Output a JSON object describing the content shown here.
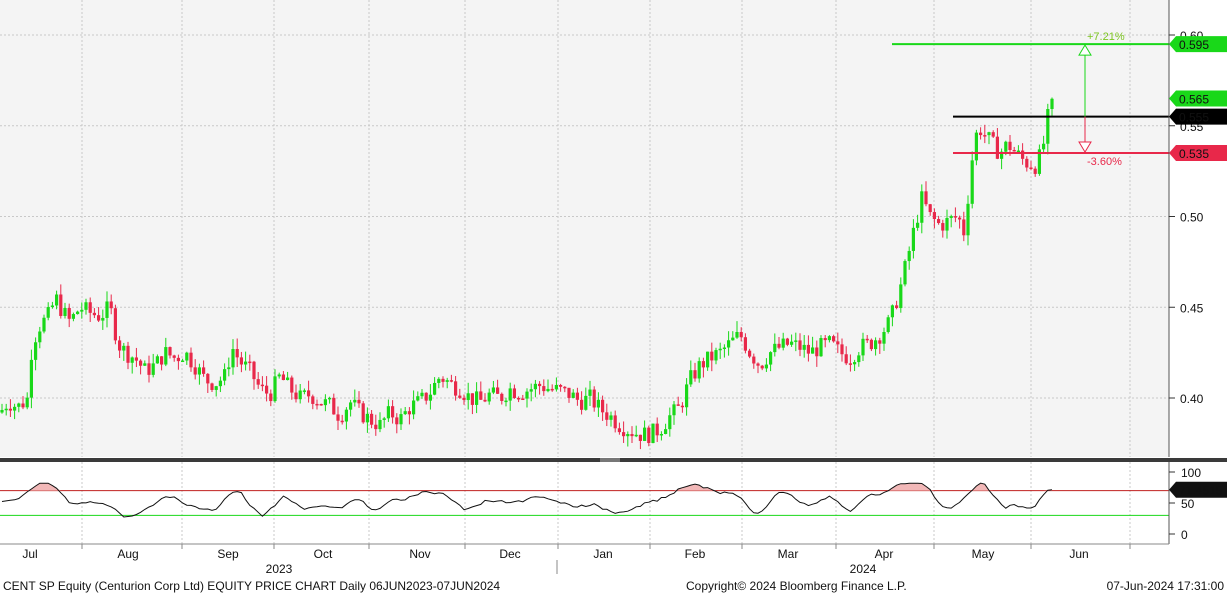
{
  "chart_data": [
    {
      "type": "candlestick",
      "x_months": [
        "Jul",
        "Aug",
        "Sep",
        "Oct",
        "Nov",
        "Dec",
        "Jan",
        "Feb",
        "Mar",
        "Apr",
        "May",
        "Jun"
      ],
      "x_years": [
        "2023",
        "2024"
      ],
      "y_ticks": [
        "0.40",
        "0.45",
        "0.50",
        "0.55",
        "0.60"
      ],
      "y_values": [
        0.4,
        0.45,
        0.5,
        0.55,
        0.6
      ],
      "ylim": [
        0.37,
        0.625
      ],
      "grid": true,
      "close_path": [
        [
          0,
          0.392
        ],
        [
          8,
          0.398
        ],
        [
          18,
          0.395
        ],
        [
          28,
          0.4
        ],
        [
          32,
          0.43
        ],
        [
          40,
          0.44
        ],
        [
          48,
          0.445
        ],
        [
          56,
          0.455
        ],
        [
          62,
          0.448
        ],
        [
          70,
          0.442
        ],
        [
          80,
          0.45
        ],
        [
          90,
          0.447
        ],
        [
          100,
          0.445
        ],
        [
          110,
          0.45
        ],
        [
          118,
          0.43
        ],
        [
          126,
          0.425
        ],
        [
          135,
          0.422
        ],
        [
          145,
          0.415
        ],
        [
          155,
          0.418
        ],
        [
          165,
          0.425
        ],
        [
          175,
          0.422
        ],
        [
          185,
          0.425
        ],
        [
          195,
          0.418
        ],
        [
          205,
          0.41
        ],
        [
          215,
          0.408
        ],
        [
          225,
          0.412
        ],
        [
          232,
          0.428
        ],
        [
          240,
          0.42
        ],
        [
          250,
          0.415
        ],
        [
          260,
          0.405
        ],
        [
          270,
          0.402
        ],
        [
          280,
          0.412
        ],
        [
          290,
          0.405
        ],
        [
          300,
          0.4
        ],
        [
          310,
          0.402
        ],
        [
          320,
          0.398
        ],
        [
          330,
          0.396
        ],
        [
          340,
          0.39
        ],
        [
          350,
          0.398
        ],
        [
          360,
          0.392
        ],
        [
          370,
          0.388
        ],
        [
          380,
          0.385
        ],
        [
          390,
          0.392
        ],
        [
          400,
          0.388
        ],
        [
          410,
          0.395
        ],
        [
          420,
          0.398
        ],
        [
          430,
          0.403
        ],
        [
          440,
          0.412
        ],
        [
          450,
          0.408
        ],
        [
          460,
          0.405
        ],
        [
          470,
          0.4
        ],
        [
          480,
          0.398
        ],
        [
          490,
          0.402
        ],
        [
          500,
          0.4
        ],
        [
          510,
          0.405
        ],
        [
          520,
          0.403
        ],
        [
          530,
          0.405
        ],
        [
          540,
          0.407
        ],
        [
          550,
          0.405
        ],
        [
          560,
          0.404
        ],
        [
          570,
          0.402
        ],
        [
          580,
          0.398
        ],
        [
          590,
          0.4
        ],
        [
          600,
          0.394
        ],
        [
          610,
          0.39
        ],
        [
          620,
          0.385
        ],
        [
          630,
          0.382
        ],
        [
          640,
          0.38
        ],
        [
          650,
          0.38
        ],
        [
          660,
          0.383
        ],
        [
          670,
          0.39
        ],
        [
          680,
          0.395
        ],
        [
          690,
          0.41
        ],
        [
          700,
          0.418
        ],
        [
          710,
          0.422
        ],
        [
          720,
          0.425
        ],
        [
          730,
          0.43
        ],
        [
          740,
          0.435
        ],
        [
          750,
          0.425
        ],
        [
          760,
          0.418
        ],
        [
          770,
          0.425
        ],
        [
          780,
          0.428
        ],
        [
          790,
          0.43
        ],
        [
          800,
          0.428
        ],
        [
          810,
          0.425
        ],
        [
          820,
          0.428
        ],
        [
          830,
          0.43
        ],
        [
          840,
          0.425
        ],
        [
          850,
          0.422
        ],
        [
          860,
          0.428
        ],
        [
          870,
          0.43
        ],
        [
          880,
          0.435
        ],
        [
          890,
          0.442
        ],
        [
          900,
          0.46
        ],
        [
          908,
          0.478
        ],
        [
          915,
          0.495
        ],
        [
          922,
          0.51
        ],
        [
          930,
          0.5
        ],
        [
          940,
          0.495
        ],
        [
          950,
          0.498
        ],
        [
          958,
          0.5
        ],
        [
          965,
          0.49
        ],
        [
          970,
          0.525
        ],
        [
          978,
          0.55
        ],
        [
          985,
          0.545
        ],
        [
          992,
          0.54
        ],
        [
          1000,
          0.535
        ],
        [
          1008,
          0.54
        ],
        [
          1016,
          0.535
        ],
        [
          1025,
          0.53
        ],
        [
          1035,
          0.528
        ],
        [
          1042,
          0.535
        ],
        [
          1048,
          0.555
        ],
        [
          1055,
          0.565
        ]
      ],
      "levels": [
        {
          "value": "0.595",
          "color": "#19d819",
          "text_color": "#111111",
          "change": "+7.21%"
        },
        {
          "value": "0.565",
          "color": "#19d819",
          "text_color": "#111111"
        },
        {
          "value": "0.555",
          "color": "#000000",
          "text_color": "#ffffff"
        },
        {
          "value": "0.535",
          "color": "#e8284a",
          "text_color": "#ffffff",
          "change": "-3.60%"
        }
      ]
    },
    {
      "type": "line",
      "y_ticks": [
        "0",
        "50",
        "100"
      ],
      "y_values": [
        0,
        50,
        100
      ],
      "ylim": [
        -12,
        110
      ],
      "last_value": "71.4515",
      "upper_band": 70,
      "lower_band": 30
    }
  ],
  "footer": {
    "left": "CENT SP Equity (Centurion Corp Ltd) EQUITY PRICE CHART  Daily 06JUN2023-07JUN2024",
    "center": "Copyright© 2024 Bloomberg Finance L.P.",
    "right": "07-Jun-2024 17:31:00"
  },
  "colors": {
    "up": "#19d819",
    "down": "#e8284a",
    "plot_bg": "#f4f4f4",
    "grid": "#c8c8c8"
  }
}
